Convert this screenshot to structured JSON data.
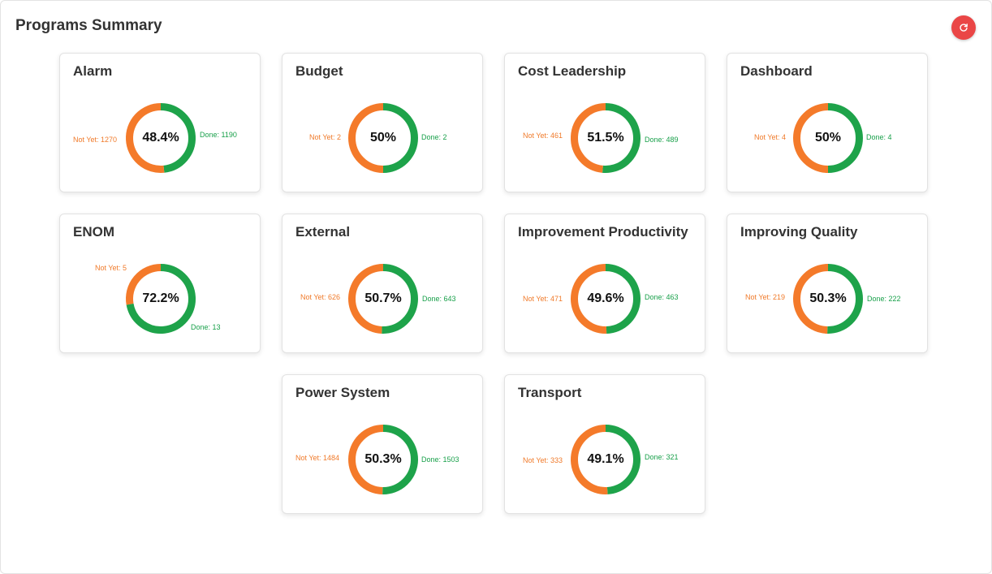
{
  "header": {
    "title": "Programs Summary"
  },
  "colors": {
    "done": "#1ea34a",
    "not_yet": "#f47a2a",
    "refresh_button": "#ea4646"
  },
  "refresh_icon": "refresh-icon",
  "programs": [
    {
      "name": "Alarm",
      "percent_label": "48.4%",
      "not_yet_label": "Not Yet: 1270",
      "done_label": "Done: 1190",
      "not_yet": 1270,
      "done": 1190
    },
    {
      "name": "Budget",
      "percent_label": "50%",
      "not_yet_label": "Not Yet: 2",
      "done_label": "Done: 2",
      "not_yet": 2,
      "done": 2
    },
    {
      "name": "Cost Leadership",
      "percent_label": "51.5%",
      "not_yet_label": "Not Yet: 461",
      "done_label": "Done: 489",
      "not_yet": 461,
      "done": 489
    },
    {
      "name": "Dashboard",
      "percent_label": "50%",
      "not_yet_label": "Not Yet: 4",
      "done_label": "Done: 4",
      "not_yet": 4,
      "done": 4
    },
    {
      "name": "ENOM",
      "percent_label": "72.2%",
      "not_yet_label": "Not Yet: 5",
      "done_label": "Done: 13",
      "not_yet": 5,
      "done": 13
    },
    {
      "name": "External",
      "percent_label": "50.7%",
      "not_yet_label": "Not Yet: 626",
      "done_label": "Done: 643",
      "not_yet": 626,
      "done": 643
    },
    {
      "name": "Improvement Productivity",
      "percent_label": "49.6%",
      "not_yet_label": "Not Yet: 471",
      "done_label": "Done: 463",
      "not_yet": 471,
      "done": 463
    },
    {
      "name": "Improving Quality",
      "percent_label": "50.3%",
      "not_yet_label": "Not Yet: 219",
      "done_label": "Done: 222",
      "not_yet": 219,
      "done": 222
    },
    {
      "name": "Power System",
      "percent_label": "50.3%",
      "not_yet_label": "Not Yet: 1484",
      "done_label": "Done: 1503",
      "not_yet": 1484,
      "done": 1503
    },
    {
      "name": "Transport",
      "percent_label": "49.1%",
      "not_yet_label": "Not Yet: 333",
      "done_label": "Done: 321",
      "not_yet": 333,
      "done": 321
    }
  ]
}
